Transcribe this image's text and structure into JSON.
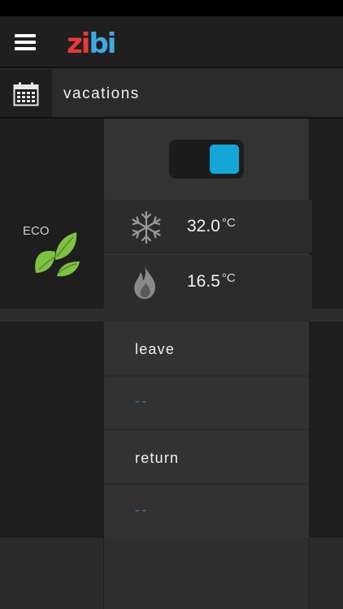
{
  "header": {
    "logo_text_part1": "zi",
    "logo_text_part2": "bi",
    "menu_icon": "hamburger-menu-icon"
  },
  "title_bar": {
    "icon": "calendar-icon",
    "title": "vacations"
  },
  "sidebar": {
    "eco_label": "ECO",
    "eco_icon": "leaf-icon",
    "eco_color": "#7dc242"
  },
  "vacation_toggle": {
    "state": "on",
    "color": "#14a6d6"
  },
  "temperatures": [
    {
      "icon": "snowflake-icon",
      "value": "32.0",
      "unit": "°C"
    },
    {
      "icon": "flame-icon",
      "value": "16.5",
      "unit": "°C"
    }
  ],
  "dates": {
    "leave_label": "leave",
    "leave_value": "--",
    "return_label": "return",
    "return_value": "--",
    "value_color": "#2d8fc4"
  }
}
